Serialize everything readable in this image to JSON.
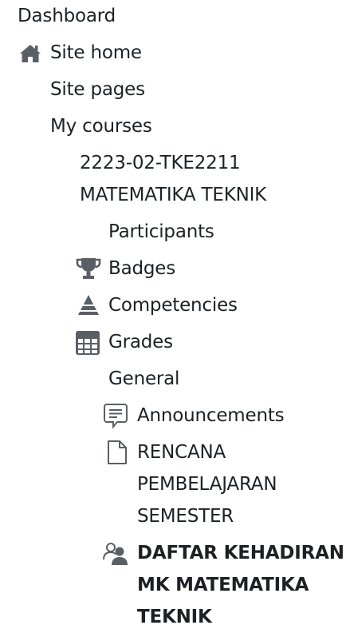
{
  "nav": {
    "dashboard": "Dashboard",
    "site_home": "Site home",
    "site_pages": "Site pages",
    "my_courses": "My courses",
    "course_title": [
      "2223-02-TKE2211",
      "MATEMATIKA TEKNIK"
    ],
    "course_items": {
      "participants": "Participants",
      "badges": "Badges",
      "competencies": "Competencies",
      "grades": "Grades",
      "general": "General"
    },
    "activities": {
      "announcements": "Announcements",
      "rps": [
        "RENCANA",
        "PEMBELAJARAN",
        "SEMESTER"
      ],
      "attendance": [
        "DAFTAR KEHADIRAN",
        "MK MATEMATIKA",
        "TEKNIK"
      ]
    }
  },
  "icons": {
    "site_home": "home-icon",
    "badges": "trophy-icon",
    "competencies": "competencies-icon",
    "grades": "grades-table-icon",
    "announcements": "forum-icon",
    "rps": "file-icon",
    "attendance": "attendance-icon"
  },
  "colors": {
    "text": "#1d2125",
    "icon": "#5a5f66"
  }
}
